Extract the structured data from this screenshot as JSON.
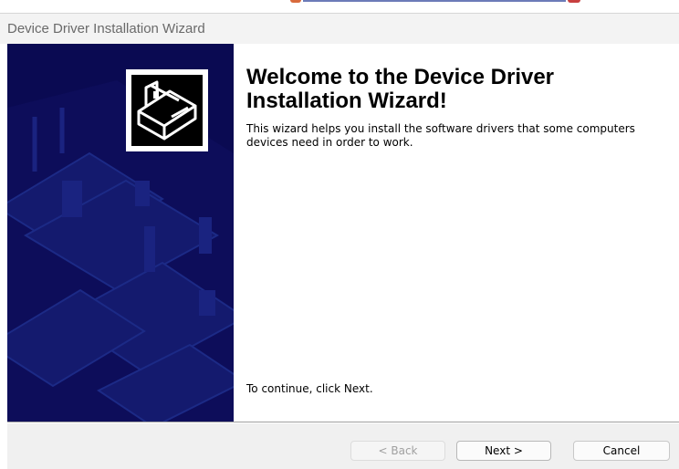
{
  "window": {
    "title": "Device Driver Installation Wizard"
  },
  "sidebar": {
    "icon": "hardware-device-icon",
    "background_color": "#0a0a52"
  },
  "content": {
    "heading": "Welcome to the Device Driver Installation Wizard!",
    "description": "This wizard helps you install the software drivers that some computers devices need in order to work.",
    "continue_text": "To continue, click Next."
  },
  "buttons": {
    "back": "< Back",
    "next": "Next >",
    "cancel": "Cancel"
  }
}
